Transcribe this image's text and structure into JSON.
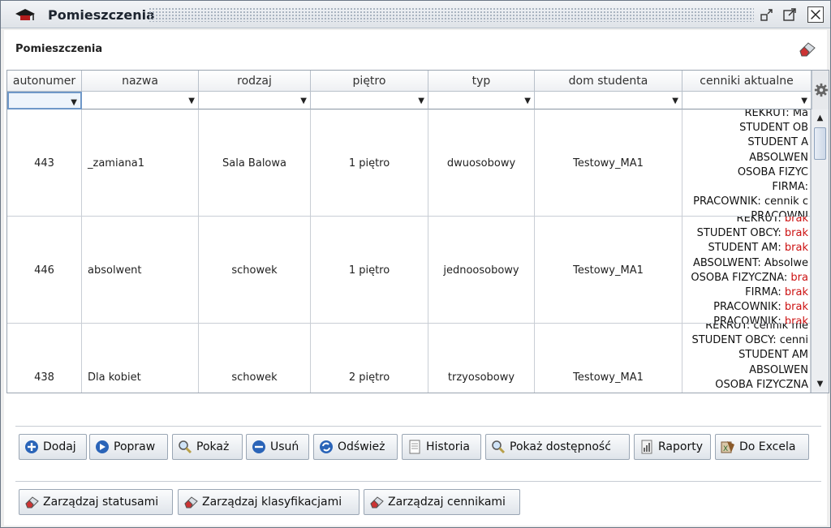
{
  "window": {
    "title": "Pomieszczenia",
    "icons": [
      "graduation-cap-icon",
      "restore-icon",
      "maximize-icon",
      "close-icon"
    ]
  },
  "page": {
    "title": "Pomieszczenia",
    "header_icon": "eraser-icon"
  },
  "table": {
    "columns": [
      "autonumer",
      "nazwa",
      "rodzaj",
      "piętro",
      "typ",
      "dom studenta",
      "cenniki aktualne"
    ],
    "rows": [
      {
        "autonumer": "443",
        "nazwa": "_zamiana1",
        "rodzaj": "Sala Balowa",
        "pietro": "1 piętro",
        "typ": "dwuosobowy",
        "dom": "Testowy_MA1",
        "cenniki": [
          {
            "t": "REKRUT: Ma",
            "r": ""
          },
          {
            "t": "STUDENT OB",
            "r": ""
          },
          {
            "t": "STUDENT A",
            "r": ""
          },
          {
            "t": "ABSOLWEN",
            "r": ""
          },
          {
            "t": "OSOBA FIZYC",
            "r": ""
          },
          {
            "t": "FIRMA:",
            "r": ""
          },
          {
            "t": "PRACOWNIK: cennik c",
            "r": ""
          },
          {
            "t": "PRACOWNI",
            "r": ""
          }
        ]
      },
      {
        "autonumer": "446",
        "nazwa": "absolwent",
        "rodzaj": "schowek",
        "pietro": "1 piętro",
        "typ": "jednoosobowy",
        "dom": "Testowy_MA1",
        "cenniki": [
          {
            "t": "REKRUT: ",
            "r": "brak"
          },
          {
            "t": "STUDENT OBCY: ",
            "r": "brak"
          },
          {
            "t": "STUDENT AM: ",
            "r": "brak"
          },
          {
            "t": "ABSOLWENT: Absolwe",
            "r": ""
          },
          {
            "t": "OSOBA FIZYCZNA: ",
            "r": "bra"
          },
          {
            "t": "FIRMA: ",
            "r": "brak"
          },
          {
            "t": "PRACOWNIK: ",
            "r": "brak"
          },
          {
            "t": "PRACOWNIK: ",
            "r": "brak"
          }
        ]
      },
      {
        "autonumer": "438",
        "nazwa": "Dla kobiet",
        "rodzaj": "schowek",
        "pietro": "2 piętro",
        "typ": "trzyosobowy",
        "dom": "Testowy_MA1",
        "cenniki": [
          {
            "t": "REKRUT: cennik me",
            "r": ""
          },
          {
            "t": "STUDENT OBCY: cenni",
            "r": ""
          },
          {
            "t": "STUDENT AM",
            "r": ""
          },
          {
            "t": "ABSOLWEN",
            "r": ""
          },
          {
            "t": "OSOBA FIZYCZNA",
            "r": ""
          }
        ]
      }
    ]
  },
  "buttons_row1": [
    {
      "label": "Dodaj",
      "icon": "plus-circle-icon",
      "color": "#2a64b8"
    },
    {
      "label": "Popraw",
      "icon": "arrow-circle-icon",
      "color": "#2a64b8"
    },
    {
      "label": "Pokaż",
      "icon": "magnifier-icon",
      "color": "#b8a04a"
    },
    {
      "label": "Usuń",
      "icon": "minus-circle-icon",
      "color": "#2a64b8"
    },
    {
      "label": "Odśwież",
      "icon": "refresh-circle-icon",
      "color": "#2a64b8"
    },
    {
      "label": "Historia",
      "icon": "document-icon",
      "color": "#888888"
    },
    {
      "label": "Pokaż dostępność",
      "icon": "magnifier-icon",
      "color": "#b8a04a"
    },
    {
      "label": "Raporty",
      "icon": "report-icon",
      "color": "#888888"
    },
    {
      "label": "Do Excela",
      "icon": "excel-icon",
      "color": "#8a5a2a"
    }
  ],
  "buttons_row2": [
    {
      "label": "Zarządzaj statusami",
      "icon": "eraser-icon"
    },
    {
      "label": "Zarządzaj klasyfikacjami",
      "icon": "eraser-icon"
    },
    {
      "label": "Zarządzaj cennikami",
      "icon": "eraser-icon"
    }
  ]
}
